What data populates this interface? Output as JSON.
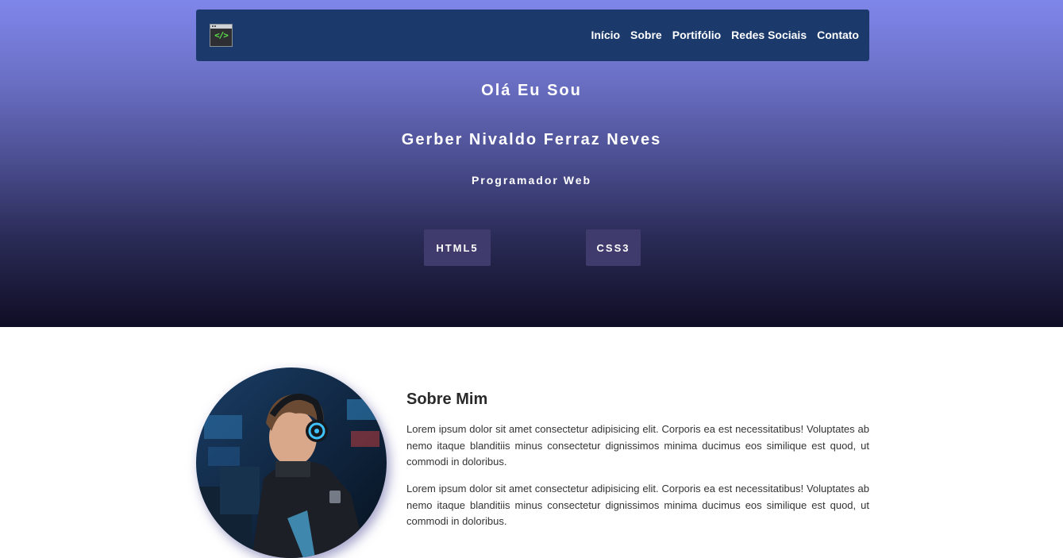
{
  "nav": {
    "logo_text": "</>",
    "links": [
      "Início",
      "Sobre",
      "Portifólio",
      "Redes Sociais",
      "Contato"
    ]
  },
  "hero": {
    "greeting": "Olá Eu Sou",
    "name": "Gerber Nivaldo Ferraz Neves",
    "role": "Programador Web",
    "skills": [
      "HTML5",
      "CSS3"
    ]
  },
  "about": {
    "title": "Sobre Mim",
    "paragraphs": [
      "Lorem ipsum dolor sit amet consectetur adipisicing elit. Corporis ea est necessitatibus! Voluptates ab nemo itaque blanditiis minus consectetur dignissimos minima ducimus eos similique est quod, ut commodi in doloribus.",
      "Lorem ipsum dolor sit amet consectetur adipisicing elit. Corporis ea est necessitatibus! Voluptates ab nemo itaque blanditiis minus consectetur dignissimos minima ducimus eos similique est quod, ut commodi in doloribus."
    ]
  },
  "colors": {
    "nav_bg": "#1b3a6b",
    "gradient_top": "#7f86ea",
    "gradient_bottom": "#0f0d24",
    "skill_bg": "#3f3b6c",
    "logo_code": "#5de34a"
  }
}
